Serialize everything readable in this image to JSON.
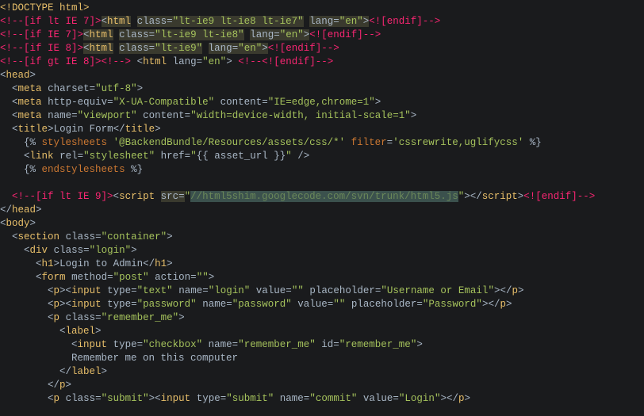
{
  "lines": {
    "l1": {
      "doctype_open": "<!",
      "doctype_kw": "DOCTYPE ",
      "doctype_val": "html",
      "doctype_close": ">"
    },
    "l2": {
      "cmt_open": "<!--[if lt IE 7]>",
      "tag": "html",
      "cls_attr": "class",
      "cls_val": "lt-ie9 lt-ie8 lt-ie7",
      "lang_attr": "lang",
      "lang_val": "en",
      "cmt_close": "<![endif]-->"
    },
    "l3": {
      "cmt_open": "<!--[if IE 7]>",
      "tag": "html",
      "cls_attr": "class",
      "cls_val": "lt-ie9 lt-ie8",
      "lang_attr": "lang",
      "lang_val": "en",
      "cmt_close": "<![endif]-->"
    },
    "l4": {
      "cmt_open": "<!--[if IE 8]>",
      "tag": "html",
      "cls_attr": "class",
      "cls_val": "lt-ie9",
      "lang_attr": "lang",
      "lang_val": "en",
      "cmt_close": "<![endif]-->"
    },
    "l5": {
      "cmt_open": "<!--[if gt IE 8]>",
      "cmt_mid": "<!-->",
      "tag": "html",
      "lang_attr": "lang",
      "lang_val": "en",
      "cmt_close": "<!--<![endif]-->"
    },
    "l6": {
      "tag": "head"
    },
    "l7": {
      "tag": "meta",
      "a1": "charset",
      "v1": "utf-8"
    },
    "l8": {
      "tag": "meta",
      "a1": "http-equiv",
      "v1": "X-UA-Compatible",
      "a2": "content",
      "v2": "IE=edge,chrome=1"
    },
    "l9": {
      "tag": "meta",
      "a1": "name",
      "v1": "viewport",
      "a2": "content",
      "v2": "width=device-width, initial-scale=1"
    },
    "l10": {
      "tag": "title",
      "text": "Login Form"
    },
    "l11": {
      "pct_open": "{%",
      "kw": "stylesheets",
      "str": "'@BackendBundle/Resources/assets/css/*'",
      "kw2": "filter",
      "eq": "=",
      "str2": "'cssrewrite,uglifycss'",
      "pct_close": "%}"
    },
    "l12": {
      "tag": "link",
      "a1": "rel",
      "v1": "stylesheet",
      "a2": "href",
      "v2": "{{ asset_url }}"
    },
    "l13": {
      "pct_open": "{%",
      "kw": "endstylesheets",
      "pct_close": "%}"
    },
    "l14": {
      "cmt_open": "<!--[if lt IE 9]>",
      "tag": "script",
      "a1": "src",
      "v1": "//html5shim.googlecode.com/svn/trunk/html5.js",
      "close_tag": "script",
      "cmt_close": "<![endif]-->"
    },
    "l15": {
      "tag": "head"
    },
    "l16": {
      "tag": "body"
    },
    "l17": {
      "tag": "section",
      "a1": "class",
      "v1": "container"
    },
    "l18": {
      "tag": "div",
      "a1": "class",
      "v1": "login"
    },
    "l19": {
      "tag": "h1",
      "text": "Login to Admin"
    },
    "l20": {
      "tag": "form",
      "a1": "method",
      "v1": "post",
      "a2": "action",
      "v2": ""
    },
    "l21": {
      "tag": "p",
      "itag": "input",
      "a1": "type",
      "v1": "text",
      "a2": "name",
      "v2": "login",
      "a3": "value",
      "v3": "",
      "a4": "placeholder",
      "v4": "Username or Email"
    },
    "l22": {
      "tag": "p",
      "itag": "input",
      "a1": "type",
      "v1": "password",
      "a2": "name",
      "v2": "password",
      "a3": "value",
      "v3": "",
      "a4": "placeholder",
      "v4": "Password"
    },
    "l23": {
      "tag": "p",
      "a1": "class",
      "v1": "remember_me"
    },
    "l24": {
      "tag": "label"
    },
    "l25": {
      "tag": "input",
      "a1": "type",
      "v1": "checkbox",
      "a2": "name",
      "v2": "remember_me",
      "a3": "id",
      "v3": "remember_me"
    },
    "l26": {
      "text": "Remember me on this computer"
    },
    "l27": {
      "tag": "label"
    },
    "l28": {
      "tag": "p"
    },
    "l29": {
      "tag": "p",
      "a1": "class",
      "v1": "submit",
      "itag": "input",
      "ia1": "type",
      "iv1": "submit",
      "ia2": "name",
      "iv2": "commit",
      "ia3": "value",
      "iv3": "Login"
    }
  }
}
